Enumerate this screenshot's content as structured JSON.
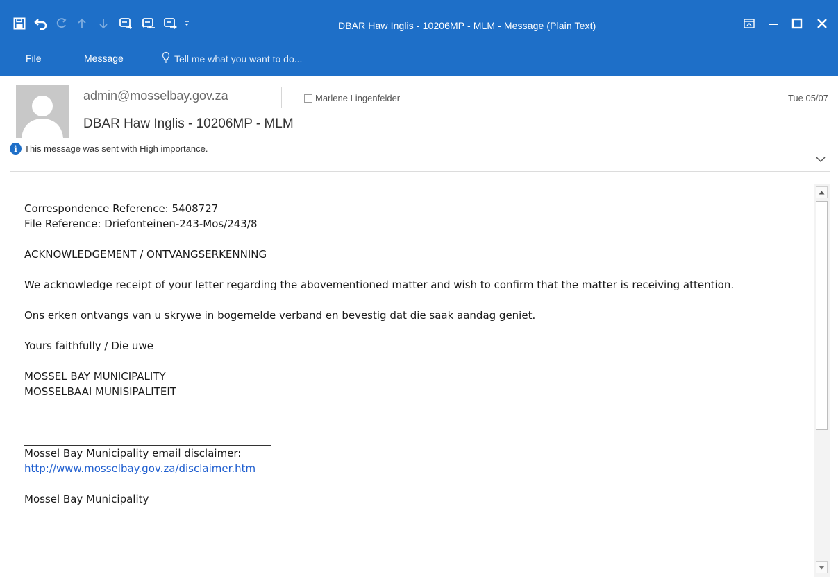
{
  "window": {
    "title": "DBAR Haw Inglis - 10206MP - MLM - Message (Plain Text)"
  },
  "ribbon": {
    "tabs": [
      "File",
      "Message"
    ],
    "tell_me_placeholder": "Tell me what you want to do..."
  },
  "header": {
    "sender": "admin@mosselbay.gov.za",
    "recipient": "Marlene Lingenfelder",
    "date": "Tue 05/07",
    "subject": "DBAR Haw Inglis - 10206MP - MLM",
    "importance_notice": "This message was sent with High importance."
  },
  "body": {
    "correspondence_ref": "Correspondence Reference: 5408727",
    "file_ref": "File Reference: Driefonteinen-243-Mos/243/8",
    "ack_title": "ACKNOWLEDGEMENT / ONTVANGSERKENNING",
    "para_en": "We acknowledge receipt of your letter regarding the abovementioned matter and wish to confirm that the matter is receiving attention.",
    "para_af": "Ons erken ontvangs van u skrywe in bogemelde verband en bevestig dat die saak aandag geniet.",
    "closing": "Yours faithfully  / Die uwe",
    "org_en": "MOSSEL BAY MUNICIPALITY",
    "org_af": "MOSSELBAAI MUNISIPALITEIT",
    "disclaimer_label": "Mossel Bay Municipality email disclaimer:",
    "disclaimer_link": "http://www.mosselbay.gov.za/disclaimer.htm",
    "trailing_text": "Mossel Bay Municipality"
  },
  "colors": {
    "titlebar": "#1e6fc8",
    "link": "#1e5ecf"
  }
}
